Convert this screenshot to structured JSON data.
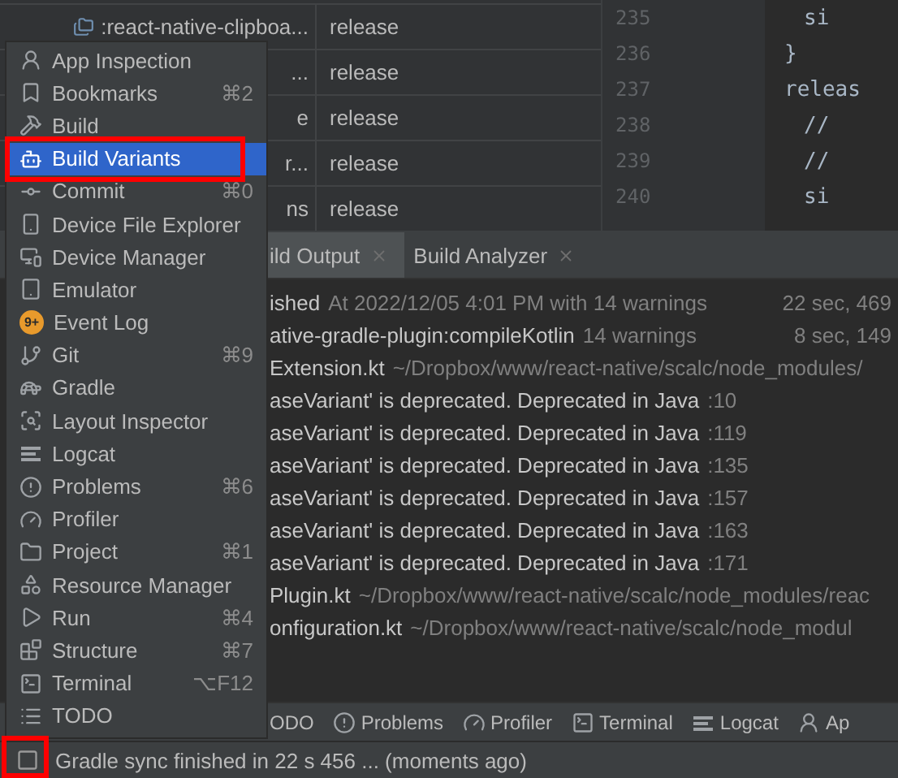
{
  "variants_table": {
    "rows": [
      {
        "module": ":react-native-clipboa...",
        "variant": "release"
      },
      {
        "module": "...",
        "variant": "release"
      },
      {
        "module": "e",
        "variant": "release"
      },
      {
        "module": "r...",
        "variant": "release"
      },
      {
        "module": "ns",
        "variant": "release"
      }
    ]
  },
  "editor": {
    "lines": [
      {
        "number": "235",
        "code": "si",
        "kind": "inner"
      },
      {
        "number": "236",
        "code": "}",
        "kind": "outer"
      },
      {
        "number": "237",
        "code": "releas",
        "kind": "outer"
      },
      {
        "number": "238",
        "code": "//",
        "kind": "inner"
      },
      {
        "number": "239",
        "code": "//",
        "kind": "inner"
      },
      {
        "number": "240",
        "code": "si",
        "kind": "inner"
      }
    ]
  },
  "build_panel": {
    "tabs": [
      {
        "label": "ild Output",
        "selected": true
      },
      {
        "label": "Build Analyzer",
        "selected": false
      }
    ],
    "lines": [
      {
        "name": "ished",
        "detail": "At 2022/12/05 4:01 PM with 14 warnings",
        "time": "22 sec, 469"
      },
      {
        "name": "ative-gradle-plugin:compileKotlin",
        "detail": "14 warnings",
        "time": "8 sec, 149"
      },
      {
        "name": "Extension.kt",
        "detail": "~/Dropbox/www/react-native/scalc/node_modules/"
      },
      {
        "name": "aseVariant' is deprecated. Deprecated in Java",
        "detail": ":10"
      },
      {
        "name": "aseVariant' is deprecated. Deprecated in Java",
        "detail": ":119"
      },
      {
        "name": "aseVariant' is deprecated. Deprecated in Java",
        "detail": ":135"
      },
      {
        "name": "aseVariant' is deprecated. Deprecated in Java",
        "detail": ":157"
      },
      {
        "name": "aseVariant' is deprecated. Deprecated in Java",
        "detail": ":163"
      },
      {
        "name": "aseVariant' is deprecated. Deprecated in Java",
        "detail": ":171"
      },
      {
        "name": "Plugin.kt",
        "detail": "~/Dropbox/www/react-native/scalc/node_modules/reac"
      },
      {
        "name": "onfiguration.kt",
        "detail": "~/Dropbox/www/react-native/scalc/node_modul"
      }
    ]
  },
  "tool_window_bar": [
    "ODO",
    "Problems",
    "Profiler",
    "Terminal",
    "Logcat",
    "Ap"
  ],
  "tool_windows_menu": {
    "items": [
      {
        "label": "App Inspection",
        "selected": false
      },
      {
        "label": "Bookmarks",
        "shortcut": "⌘2",
        "selected": false
      },
      {
        "label": "Build",
        "selected": false
      },
      {
        "label": "Build Variants",
        "selected": true
      },
      {
        "label": "Commit",
        "shortcut": "⌘0",
        "selected": false
      },
      {
        "label": "Device File Explorer",
        "selected": false
      },
      {
        "label": "Device Manager",
        "selected": false
      },
      {
        "label": "Emulator",
        "selected": false
      },
      {
        "label": "Event Log",
        "badge": "9+",
        "selected": false
      },
      {
        "label": "Git",
        "shortcut": "⌘9",
        "selected": false
      },
      {
        "label": "Gradle",
        "selected": false
      },
      {
        "label": "Layout Inspector",
        "selected": false
      },
      {
        "label": "Logcat",
        "selected": false
      },
      {
        "label": "Problems",
        "shortcut": "⌘6",
        "selected": false
      },
      {
        "label": "Profiler",
        "selected": false
      },
      {
        "label": "Project",
        "shortcut": "⌘1",
        "selected": false
      },
      {
        "label": "Resource Manager",
        "selected": false
      },
      {
        "label": "Run",
        "shortcut": "⌘4",
        "selected": false
      },
      {
        "label": "Structure",
        "shortcut": "⌘7",
        "selected": false
      },
      {
        "label": "Terminal",
        "shortcut": "⌥F12",
        "selected": false
      },
      {
        "label": "TODO",
        "selected": false
      }
    ]
  },
  "status_bar": {
    "message": "Gradle sync finished in 22 s 456 ... (moments ago)"
  }
}
